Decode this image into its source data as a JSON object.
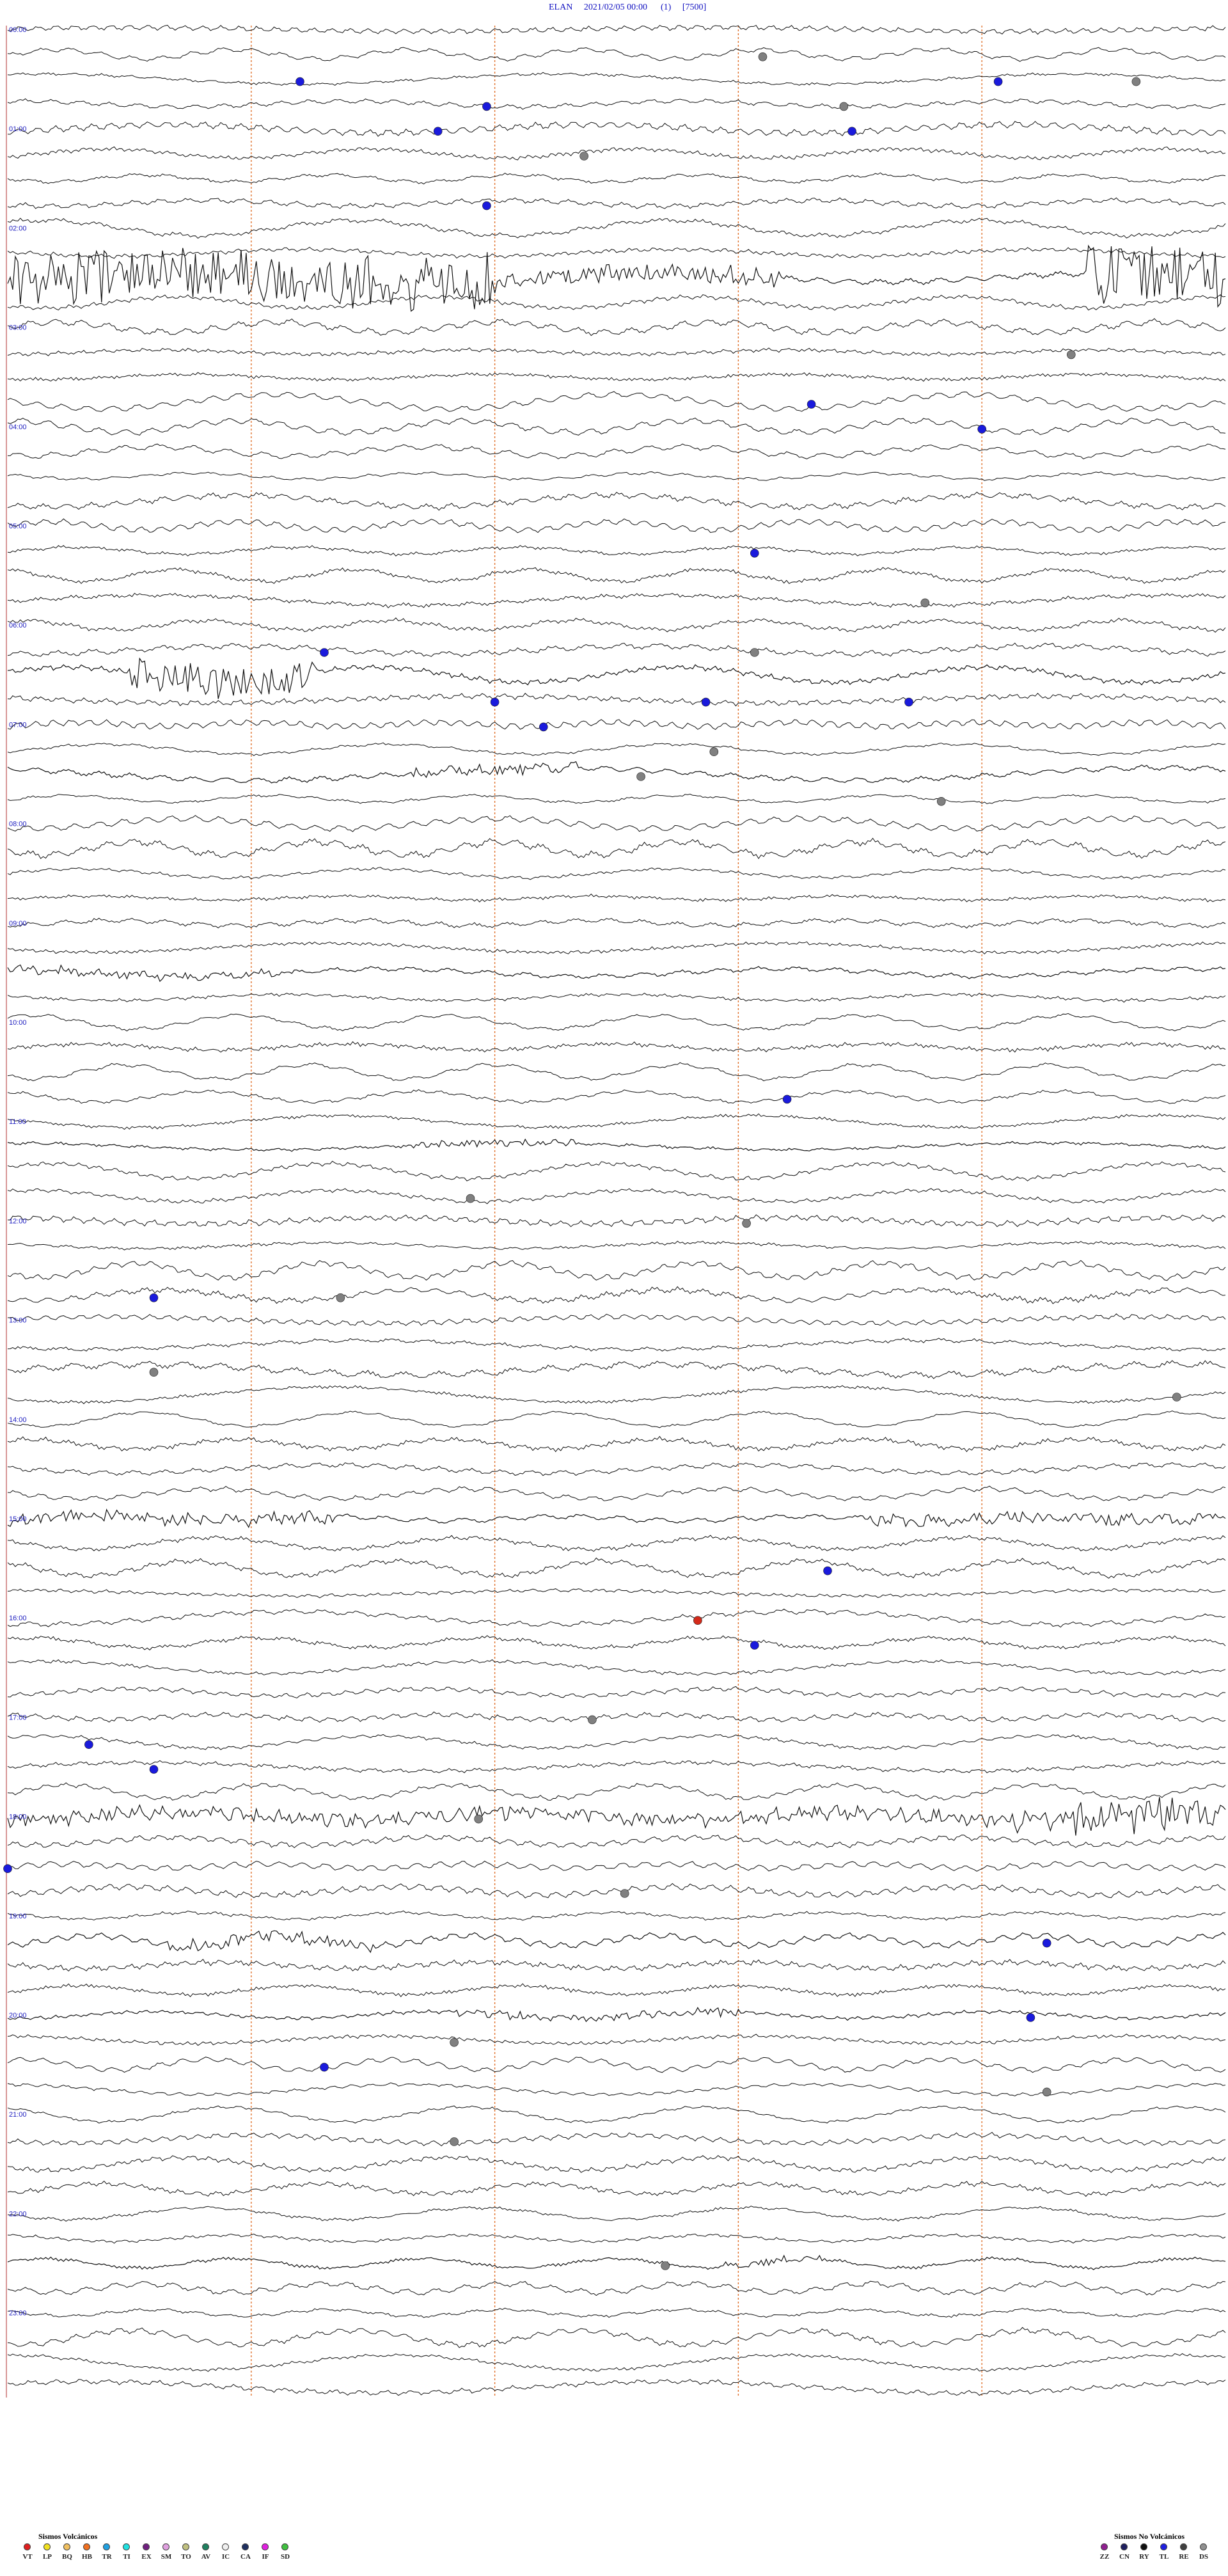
{
  "header": {
    "station": "ELAN",
    "datetime": "2021/02/05 00:00",
    "index": "(1)",
    "scale": "[7500]"
  },
  "chart_data": {
    "type": "seismogram",
    "lines_total": 96,
    "minutes_per_line": 15,
    "hour_labels": [
      "00:00",
      "01:00",
      "02:00",
      "03:00",
      "04:00",
      "05:00",
      "06:00",
      "07:00",
      "08:00",
      "09:00",
      "10:00",
      "11:00",
      "12:00",
      "13:00",
      "14:00",
      "15:00",
      "16:00",
      "17:00",
      "18:00",
      "19:00",
      "20:00",
      "21:00",
      "22:00",
      "23:00"
    ],
    "minute_marks": [
      3,
      6,
      9,
      12
    ],
    "event_groups": {
      "blue": "#1a1adc",
      "gray": "#808080",
      "red": "#d42a1a"
    },
    "events": [
      {
        "line": 2,
        "minute": 3.6,
        "type": "blue"
      },
      {
        "line": 3,
        "minute": 5.9,
        "type": "blue"
      },
      {
        "line": 2,
        "minute": 12.2,
        "type": "blue"
      },
      {
        "line": 2,
        "minute": 13.9,
        "type": "gray"
      },
      {
        "line": 1,
        "minute": 9.3,
        "type": "gray"
      },
      {
        "line": 3,
        "minute": 10.3,
        "type": "gray"
      },
      {
        "line": 4,
        "minute": 5.3,
        "type": "blue"
      },
      {
        "line": 4,
        "minute": 10.4,
        "type": "blue"
      },
      {
        "line": 5,
        "minute": 7.1,
        "type": "gray"
      },
      {
        "line": 7,
        "minute": 5.9,
        "type": "blue"
      },
      {
        "line": 13,
        "minute": 13.1,
        "type": "gray"
      },
      {
        "line": 15,
        "minute": 9.9,
        "type": "blue"
      },
      {
        "line": 16,
        "minute": 12.0,
        "type": "blue"
      },
      {
        "line": 21,
        "minute": 9.2,
        "type": "blue"
      },
      {
        "line": 23,
        "minute": 11.3,
        "type": "gray"
      },
      {
        "line": 25,
        "minute": 3.9,
        "type": "blue"
      },
      {
        "line": 25,
        "minute": 9.2,
        "type": "gray"
      },
      {
        "line": 27,
        "minute": 8.6,
        "type": "blue"
      },
      {
        "line": 27,
        "minute": 11.1,
        "type": "blue"
      },
      {
        "line": 27,
        "minute": 6.0,
        "type": "blue"
      },
      {
        "line": 28,
        "minute": 6.6,
        "type": "blue"
      },
      {
        "line": 29,
        "minute": 8.7,
        "type": "gray"
      },
      {
        "line": 30,
        "minute": 7.8,
        "type": "gray"
      },
      {
        "line": 31,
        "minute": 11.5,
        "type": "gray"
      },
      {
        "line": 43,
        "minute": 9.6,
        "type": "blue"
      },
      {
        "line": 47,
        "minute": 5.7,
        "type": "gray"
      },
      {
        "line": 48,
        "minute": 9.1,
        "type": "gray"
      },
      {
        "line": 51,
        "minute": 1.8,
        "type": "blue"
      },
      {
        "line": 51,
        "minute": 4.1,
        "type": "gray"
      },
      {
        "line": 54,
        "minute": 1.8,
        "type": "gray"
      },
      {
        "line": 55,
        "minute": 14.4,
        "type": "gray"
      },
      {
        "line": 62,
        "minute": 10.1,
        "type": "blue"
      },
      {
        "line": 64,
        "minute": 8.5,
        "type": "red"
      },
      {
        "line": 65,
        "minute": 9.2,
        "type": "blue"
      },
      {
        "line": 68,
        "minute": 7.2,
        "type": "gray"
      },
      {
        "line": 69,
        "minute": 1.0,
        "type": "blue"
      },
      {
        "line": 70,
        "minute": 1.8,
        "type": "blue"
      },
      {
        "line": 72,
        "minute": 5.8,
        "type": "gray"
      },
      {
        "line": 74,
        "minute": 0.0,
        "type": "blue"
      },
      {
        "line": 75,
        "minute": 7.6,
        "type": "gray"
      },
      {
        "line": 77,
        "minute": 12.8,
        "type": "blue"
      },
      {
        "line": 80,
        "minute": 12.6,
        "type": "blue"
      },
      {
        "line": 81,
        "minute": 5.5,
        "type": "gray"
      },
      {
        "line": 82,
        "minute": 3.9,
        "type": "blue"
      },
      {
        "line": 83,
        "minute": 12.8,
        "type": "gray"
      },
      {
        "line": 85,
        "minute": 5.5,
        "type": "gray"
      },
      {
        "line": 90,
        "minute": 8.1,
        "type": "gray"
      }
    ],
    "bursts": [
      {
        "line": 10,
        "start": 0.0,
        "end": 6.0,
        "amp": 48
      },
      {
        "line": 10,
        "start": 6.0,
        "end": 9.5,
        "amp": 14
      },
      {
        "line": 10,
        "start": 13.3,
        "end": 15.0,
        "amp": 48
      },
      {
        "line": 26,
        "start": 1.5,
        "end": 3.8,
        "amp": 28
      },
      {
        "line": 30,
        "start": 5.0,
        "end": 7.0,
        "amp": 8
      },
      {
        "line": 38,
        "start": 0.0,
        "end": 3.5,
        "amp": 6
      },
      {
        "line": 45,
        "start": 5.0,
        "end": 7.0,
        "amp": 6
      },
      {
        "line": 60,
        "start": 0.0,
        "end": 4.0,
        "amp": 10
      },
      {
        "line": 60,
        "start": 10.5,
        "end": 15.0,
        "amp": 9
      },
      {
        "line": 72,
        "start": 0.0,
        "end": 15.0,
        "amp": 10
      },
      {
        "line": 72,
        "start": 12.4,
        "end": 15.0,
        "amp": 26
      },
      {
        "line": 77,
        "start": 2.0,
        "end": 4.5,
        "amp": 10
      },
      {
        "line": 80,
        "start": 5.5,
        "end": 9.0,
        "amp": 6
      },
      {
        "line": 90,
        "start": 8.8,
        "end": 10.0,
        "amp": 6
      }
    ]
  },
  "legend_volcanic": {
    "title": "Sismos Volcánicos",
    "items": [
      {
        "code": "VT",
        "color": "#e02020"
      },
      {
        "code": "LP",
        "color": "#f0e020"
      },
      {
        "code": "BQ",
        "color": "#f0c060"
      },
      {
        "code": "HB",
        "color": "#f07020"
      },
      {
        "code": "TR",
        "color": "#20a0e0"
      },
      {
        "code": "TI",
        "color": "#20e0e0"
      },
      {
        "code": "EX",
        "color": "#702080"
      },
      {
        "code": "SM",
        "color": "#e0a0e0"
      },
      {
        "code": "TO",
        "color": "#c0c080"
      },
      {
        "code": "AV",
        "color": "#208060"
      },
      {
        "code": "IC",
        "color": "#f0f0f0"
      },
      {
        "code": "CA",
        "color": "#203060"
      },
      {
        "code": "IF",
        "color": "#e020e0"
      },
      {
        "code": "SD",
        "color": "#40c040"
      }
    ]
  },
  "legend_nonvolcanic": {
    "title": "Sismos No Volcánicos",
    "items": [
      {
        "code": "ZZ",
        "color": "#902090"
      },
      {
        "code": "CN",
        "color": "#202060"
      },
      {
        "code": "RY",
        "color": "#101010"
      },
      {
        "code": "TL",
        "color": "#2020e0"
      },
      {
        "code": "RE",
        "color": "#404040"
      },
      {
        "code": "DS",
        "color": "#909090"
      }
    ]
  }
}
